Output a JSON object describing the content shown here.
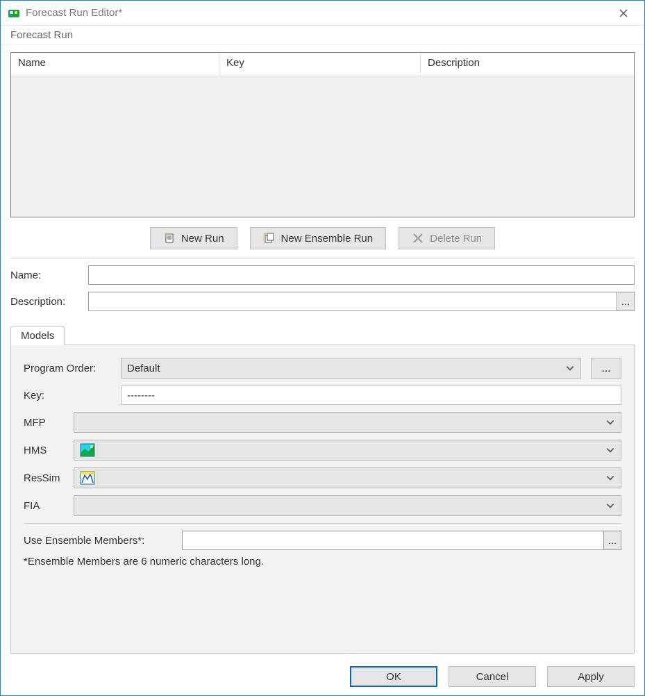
{
  "window": {
    "title": "Forecast Run Editor*"
  },
  "menu": {
    "forecast_run": "Forecast Run"
  },
  "table": {
    "headers": {
      "name": "Name",
      "key": "Key",
      "description": "Description"
    }
  },
  "run_buttons": {
    "new_run": "New Run",
    "new_ensemble_run": "New Ensemble Run",
    "delete_run": "Delete Run"
  },
  "form": {
    "name_label": "Name:",
    "name_value": "",
    "description_label": "Description:",
    "description_value": ""
  },
  "tabs": {
    "models": "Models"
  },
  "models": {
    "program_order_label": "Program Order:",
    "program_order_value": "Default",
    "more": "...",
    "key_label": "Key:",
    "key_value": "--------",
    "rows": {
      "mfp": "MFP",
      "hms": "HMS",
      "ressim": "ResSim",
      "fia": "FIA"
    },
    "uem_label": "Use Ensemble Members*:",
    "uem_value": "",
    "hint": "*Ensemble Members are 6 numeric characters long."
  },
  "dialog": {
    "ok": "OK",
    "cancel": "Cancel",
    "apply": "Apply"
  }
}
